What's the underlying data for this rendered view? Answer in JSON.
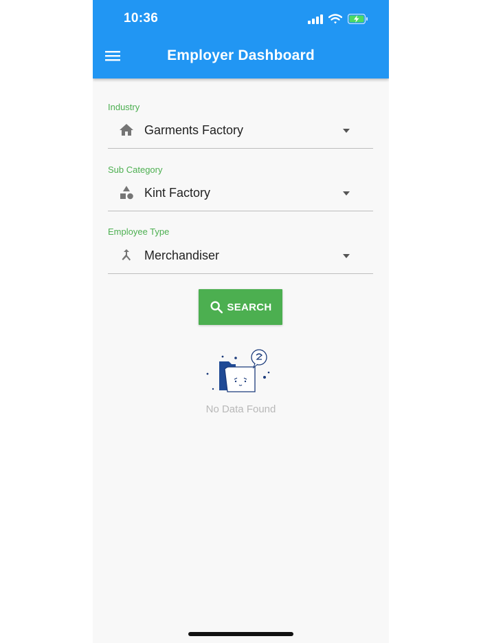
{
  "status_bar": {
    "time": "10:36",
    "icons": [
      "signal-icon",
      "wifi-icon",
      "battery-charging-icon"
    ],
    "battery_color": "#4cd964"
  },
  "app_bar": {
    "title": "Employer Dashboard",
    "background": "#2196f3",
    "menu_icon": "hamburger-menu-icon"
  },
  "filters": {
    "industry": {
      "label": "Industry",
      "value": "Garments Factory",
      "icon": "home-icon"
    },
    "sub_category": {
      "label": "Sub Category",
      "value": "Kint Factory",
      "icon": "shapes-icon"
    },
    "employee_type": {
      "label": "Employee Type",
      "value": "Merchandiser",
      "icon": "merge-icon"
    }
  },
  "search_button": {
    "label": "SEARCH",
    "icon": "search-icon",
    "color": "#4caf50"
  },
  "empty_state": {
    "message": "No Data Found",
    "icon": "empty-folder-illustration"
  },
  "accent_label_color": "#4caf50"
}
